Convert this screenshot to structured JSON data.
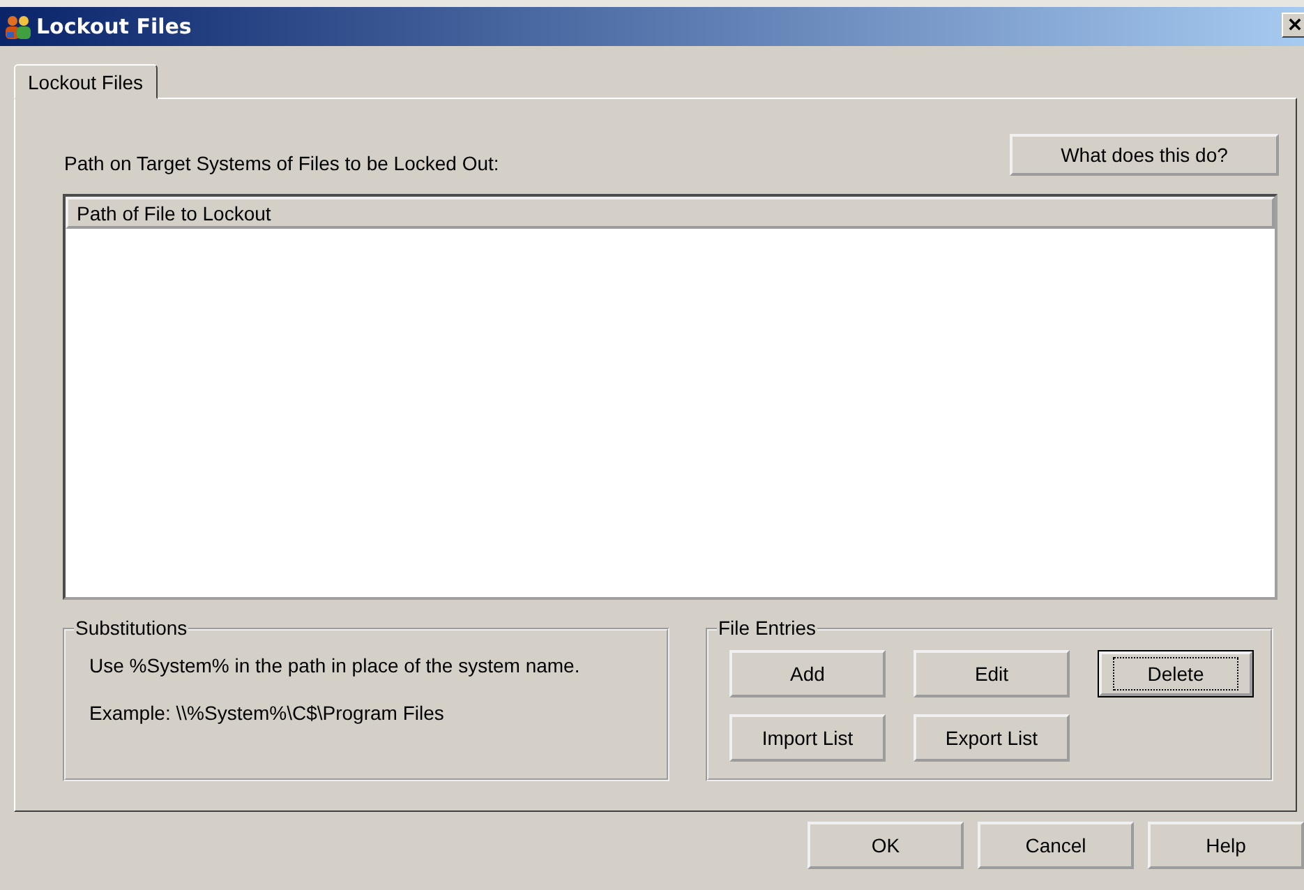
{
  "window": {
    "title": "Lockout Files"
  },
  "tabs": [
    {
      "label": "Lockout Files",
      "selected": true
    }
  ],
  "panel": {
    "label": "Path on Target Systems of Files to be Locked Out:",
    "help_button": "What does this do?",
    "list": {
      "columns": [
        "Path of File to Lockout"
      ]
    },
    "substitutions": {
      "title": "Substitutions",
      "lines": [
        "Use %System% in the path in place of the system name.",
        "Example: \\\\%System%\\C$\\Program Files"
      ]
    },
    "file_entries": {
      "title": "File Entries",
      "buttons": [
        {
          "label": "Add",
          "default": false
        },
        {
          "label": "Edit",
          "default": false
        },
        {
          "label": "Delete",
          "default": true
        },
        {
          "label": "Import List",
          "default": false
        },
        {
          "label": "Export List",
          "default": false
        }
      ]
    }
  },
  "buttons": [
    "OK",
    "Cancel",
    "Help"
  ]
}
